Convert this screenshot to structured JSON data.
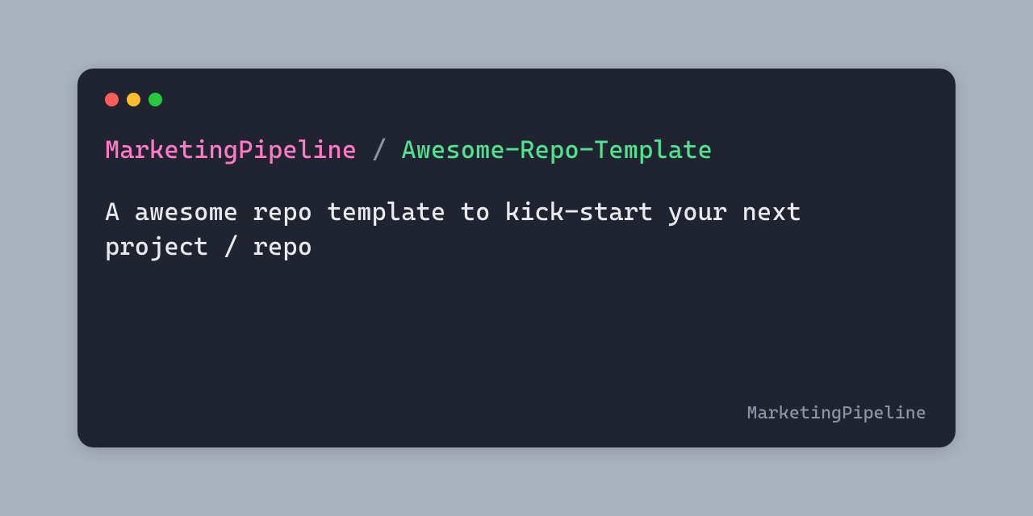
{
  "card": {
    "owner": "MarketingPipeline",
    "separator": "/",
    "repo": "Awesome-Repo-Template",
    "description": "A awesome repo template to kick-start your next project / repo",
    "footer": "MarketingPipeline"
  },
  "colors": {
    "background": "#a9b2be",
    "window": "#1f2430",
    "owner": "#ff79c6",
    "repo": "#50e28f",
    "muted": "#8b93a5",
    "text": "#e8eaed"
  }
}
